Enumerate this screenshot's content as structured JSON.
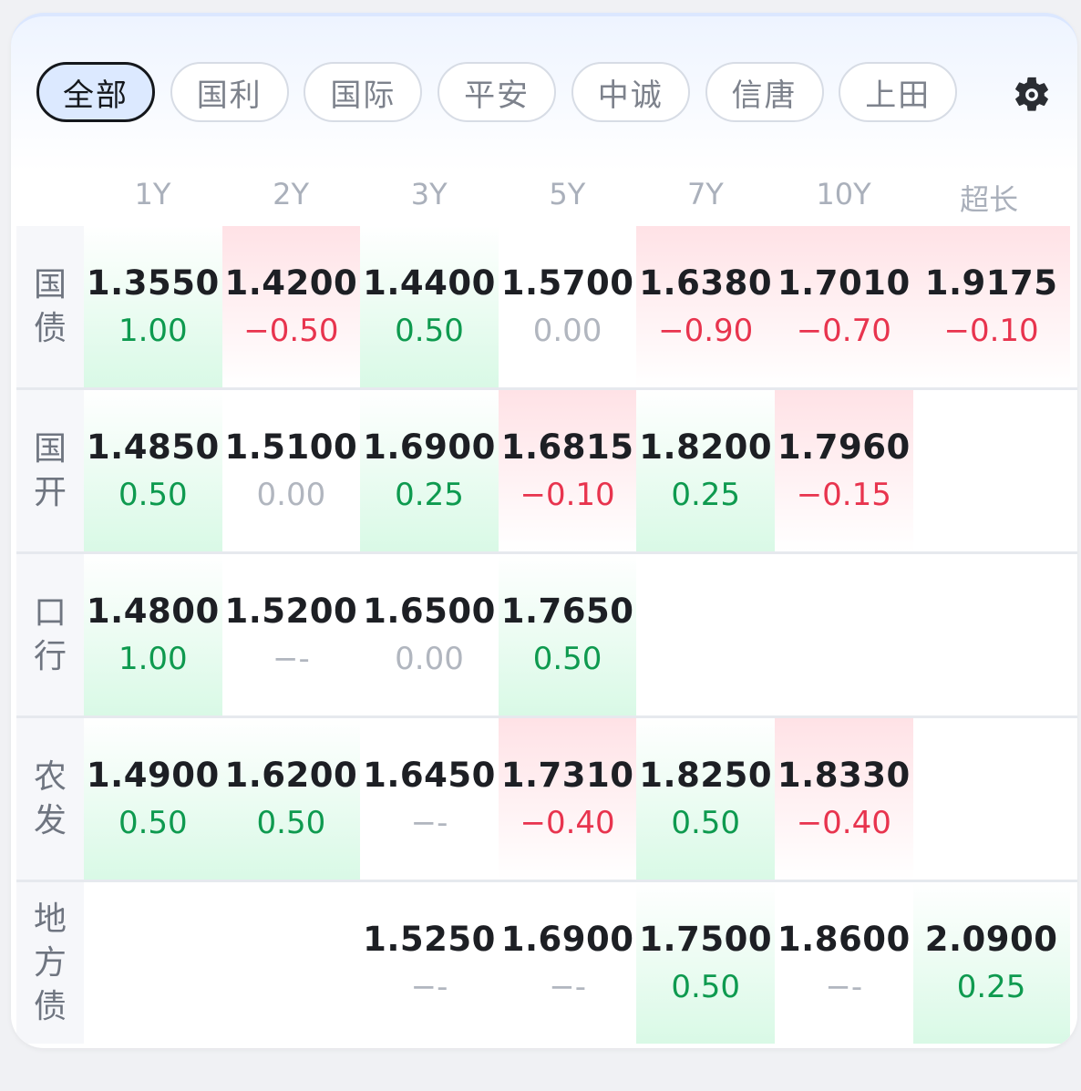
{
  "tabs": [
    {
      "label": "全部",
      "active": true
    },
    {
      "label": "国利",
      "active": false
    },
    {
      "label": "国际",
      "active": false
    },
    {
      "label": "平安",
      "active": false
    },
    {
      "label": "中诚",
      "active": false
    },
    {
      "label": "信唐",
      "active": false
    },
    {
      "label": "上田",
      "active": false
    }
  ],
  "settings_icon": "gear-icon",
  "columns": [
    "1Y",
    "2Y",
    "3Y",
    "5Y",
    "7Y",
    "10Y",
    "超长"
  ],
  "colors": {
    "up": "#0e9a4f",
    "down": "#e8344e",
    "flat": "#b1b6bf"
  },
  "rows": [
    {
      "name": "国债",
      "cells": [
        {
          "yield": "1.3550",
          "change": "1.00",
          "dir": "up"
        },
        {
          "yield": "1.4200",
          "change": "-0.50",
          "dir": "down"
        },
        {
          "yield": "1.4400",
          "change": "0.50",
          "dir": "up"
        },
        {
          "yield": "1.5700",
          "change": "0.00",
          "dir": "flat"
        },
        {
          "yield": "1.6380",
          "change": "-0.90",
          "dir": "down"
        },
        {
          "yield": "1.7010",
          "change": "-0.70",
          "dir": "down"
        },
        {
          "yield": "1.9175",
          "change": "-0.10",
          "dir": "down"
        }
      ]
    },
    {
      "name": "国开",
      "cells": [
        {
          "yield": "1.4850",
          "change": "0.50",
          "dir": "up"
        },
        {
          "yield": "1.5100",
          "change": "0.00",
          "dir": "flat"
        },
        {
          "yield": "1.6900",
          "change": "0.25",
          "dir": "up"
        },
        {
          "yield": "1.6815",
          "change": "-0.10",
          "dir": "down"
        },
        {
          "yield": "1.8200",
          "change": "0.25",
          "dir": "up"
        },
        {
          "yield": "1.7960",
          "change": "-0.15",
          "dir": "down"
        },
        null
      ]
    },
    {
      "name": "口行",
      "cells": [
        {
          "yield": "1.4800",
          "change": "1.00",
          "dir": "up"
        },
        {
          "yield": "1.5200",
          "change": "--",
          "dir": "none"
        },
        {
          "yield": "1.6500",
          "change": "0.00",
          "dir": "flat"
        },
        {
          "yield": "1.7650",
          "change": "0.50",
          "dir": "up"
        },
        null,
        null,
        null
      ]
    },
    {
      "name": "农发",
      "cells": [
        {
          "yield": "1.4900",
          "change": "0.50",
          "dir": "up"
        },
        {
          "yield": "1.6200",
          "change": "0.50",
          "dir": "up"
        },
        {
          "yield": "1.6450",
          "change": "--",
          "dir": "none"
        },
        {
          "yield": "1.7310",
          "change": "-0.40",
          "dir": "down"
        },
        {
          "yield": "1.8250",
          "change": "0.50",
          "dir": "up"
        },
        {
          "yield": "1.8330",
          "change": "-0.40",
          "dir": "down"
        },
        null
      ]
    },
    {
      "name": "地方债",
      "cells": [
        null,
        null,
        {
          "yield": "1.5250",
          "change": "--",
          "dir": "none"
        },
        {
          "yield": "1.6900",
          "change": "--",
          "dir": "none"
        },
        {
          "yield": "1.7500",
          "change": "0.50",
          "dir": "up"
        },
        {
          "yield": "1.8600",
          "change": "--",
          "dir": "none"
        },
        {
          "yield": "2.0900",
          "change": "0.25",
          "dir": "up"
        }
      ]
    }
  ]
}
